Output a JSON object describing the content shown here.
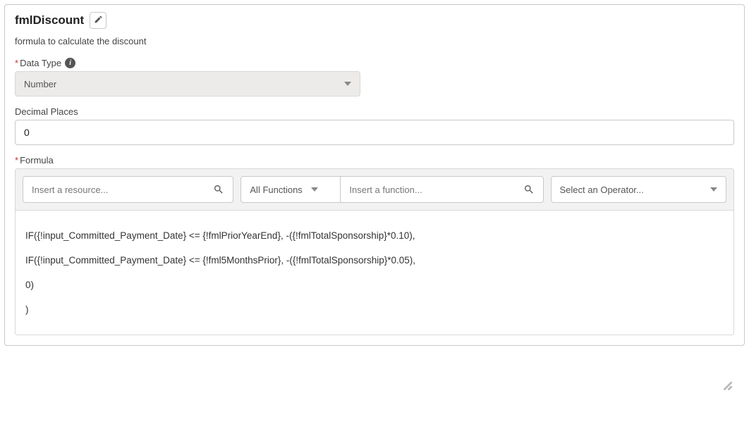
{
  "title": "fmlDiscount",
  "description": "formula to calculate the discount",
  "fields": {
    "dataType": {
      "label": "Data Type",
      "value": "Number",
      "required": true
    },
    "decimalPlaces": {
      "label": "Decimal Places",
      "value": "0"
    },
    "formula": {
      "label": "Formula",
      "required": true,
      "resourcePlaceholder": "Insert a resource...",
      "functionsFilter": "All Functions",
      "functionPlaceholder": "Insert a function...",
      "operatorPlaceholder": "Select an Operator...",
      "body": "IF({!input_Committed_Payment_Date} <= {!fmlPriorYearEnd}, -({!fmlTotalSponsorship}*0.10),\nIF({!input_Committed_Payment_Date} <= {!fml5MonthsPrior}, -({!fmlTotalSponsorship}*0.05),\n0)\n)"
    }
  }
}
